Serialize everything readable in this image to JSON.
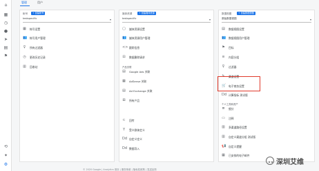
{
  "tabs": [
    "管理",
    "用户"
  ],
  "account_column": {
    "header": "帐号",
    "create_label": "+ 创建帐号",
    "selector": "testspecific",
    "items": [
      "帐号设置",
      "帐号用户管理",
      "所有过滤器",
      "更改历史记录",
      "回收站"
    ]
  },
  "property_column": {
    "header": "媒体资源",
    "create_label": "+ 创建媒体资源",
    "selector": "testspecific",
    "items": [
      "媒体资源设置",
      "媒体资源用户管理",
      "跟踪信息",
      "数据删除请求"
    ],
    "section_label": "产品关联",
    "product_links": [
      "Google Ads 关联",
      "AdSense 关联",
      "Ad Exchange 关联",
      "所有产品"
    ],
    "other_items": [
      "回传",
      "受众群体定义",
      "自定义定义",
      "数据导入"
    ]
  },
  "view_column": {
    "header": "数据视图",
    "create_label": "+ 创建数据视图",
    "selector": "原始数据视图",
    "items": [
      "数据视图设置",
      "数据视图用户管理",
      "目标",
      "内容分组",
      "过滤器",
      "渠道设置",
      "电子商务设置",
      "计算指标 测试版"
    ],
    "section_label": "个人工具和资产",
    "personal_items": [
      "细分",
      "注释",
      "多渠道路径设置",
      "自定义渠道分组 测试版",
      "自定义提醒",
      "已安排的电子邮件",
      "已保存的报告",
      "共享资产"
    ]
  },
  "footer": "© 2020 Google | Analytics 首页 | 服务条款 | 隐私权政策 | 发送反馈",
  "watermark": "深圳艾维"
}
